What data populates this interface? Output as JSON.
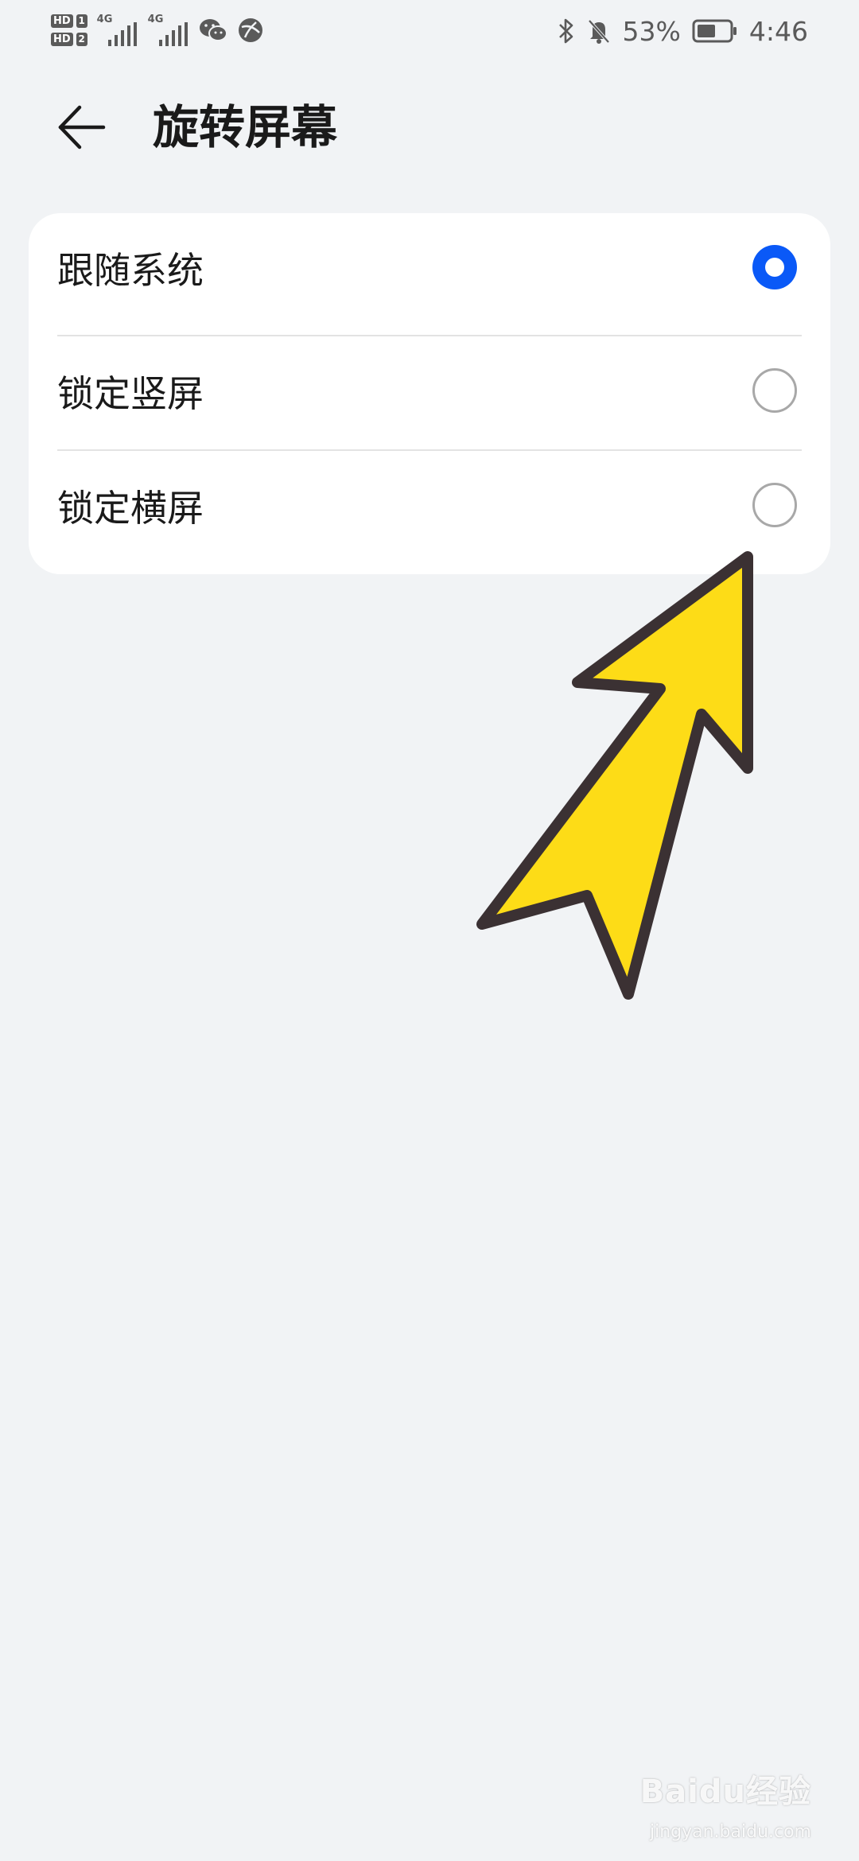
{
  "status_bar": {
    "sim1_badge": "HD",
    "sim1_number": "1",
    "sim2_badge": "HD",
    "sim2_number": "2",
    "network1": "4G",
    "network2": "4G",
    "battery_percent": "53%",
    "time": "4:46",
    "icons": [
      "signal-icon",
      "wechat-icon",
      "browser-icon",
      "bluetooth-icon",
      "bell-off-icon",
      "battery-icon"
    ]
  },
  "header": {
    "title": "旋转屏幕",
    "back_icon": "arrow-left-icon"
  },
  "options": [
    {
      "label": "跟随系统",
      "selected": true
    },
    {
      "label": "锁定竖屏",
      "selected": false
    },
    {
      "label": "锁定横屏",
      "selected": false
    }
  ],
  "colors": {
    "accent": "#0a59f7",
    "background": "#f1f3f5",
    "card": "#ffffff",
    "arrow_fill": "#fddc17",
    "arrow_stroke": "#3b3133"
  },
  "watermark": {
    "logo": "Baidu经验",
    "url": "jingyan.baidu.com"
  }
}
